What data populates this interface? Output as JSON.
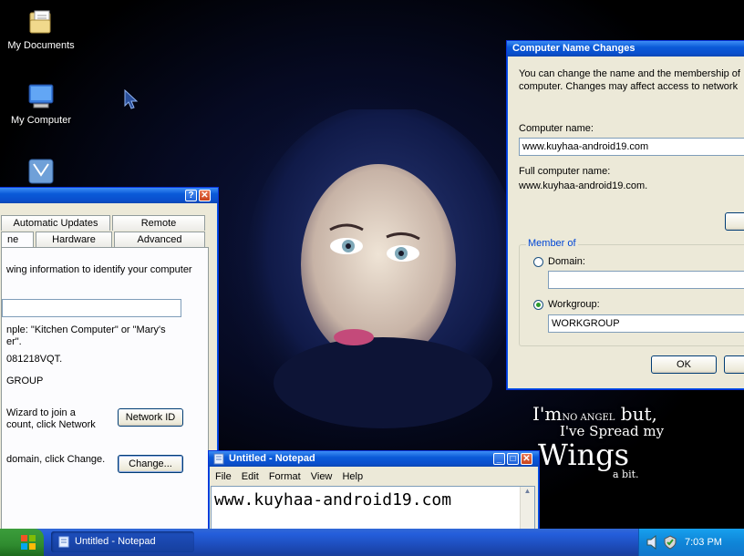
{
  "desktop": {
    "icons": [
      {
        "label": "My Documents"
      },
      {
        "label": "My Computer"
      }
    ],
    "wallpaper_text": {
      "line1_big": "I'm",
      "line1_small": "NO ANGEL",
      "line1_rest": "but,",
      "line2": "I've Spread my",
      "line3": "Wings",
      "line4": "a bit."
    }
  },
  "system_properties": {
    "tabs_row1": [
      "Automatic Updates",
      "Remote"
    ],
    "tabs_row2": [
      "ne",
      "Hardware",
      "Advanced"
    ],
    "description": "wing information to identify your computer",
    "example_line1": "nple: \"Kitchen Computer\" or \"Mary's",
    "example_line2": "er\".",
    "full_name": "081218VQT.",
    "workgroup": "GROUP",
    "wizard_line1": "Wizard to join a",
    "wizard_line2": "count, click Network",
    "network_id_button": "Network ID",
    "change_text": "domain, click Change.",
    "change_button": "Change..."
  },
  "computer_name_changes": {
    "title": "Computer Name Changes",
    "description_line1": "You can change the name and the membership of",
    "description_line2": "computer. Changes may affect access to network",
    "computer_name_label": "Computer name:",
    "computer_name_value": "www.kuyhaa-android19.com",
    "full_name_label": "Full computer name:",
    "full_name_value": "www.kuyhaa-android19.com.",
    "member_of_label": "Member of",
    "domain_label": "Domain:",
    "domain_value": "",
    "workgroup_label": "Workgroup:",
    "workgroup_value": "WORKGROUP",
    "ok_button": "OK"
  },
  "notepad": {
    "title": "Untitled - Notepad",
    "menu": [
      "File",
      "Edit",
      "Format",
      "View",
      "Help"
    ],
    "content": "www.kuyhaa-android19.com"
  },
  "taskbar": {
    "task_label": "Untitled - Notepad",
    "clock": "7:03 PM"
  },
  "colors": {
    "xp_blue": "#0a5ad8",
    "dialog_bg": "#ece9d8",
    "tray_blue": "#0f86d8"
  }
}
